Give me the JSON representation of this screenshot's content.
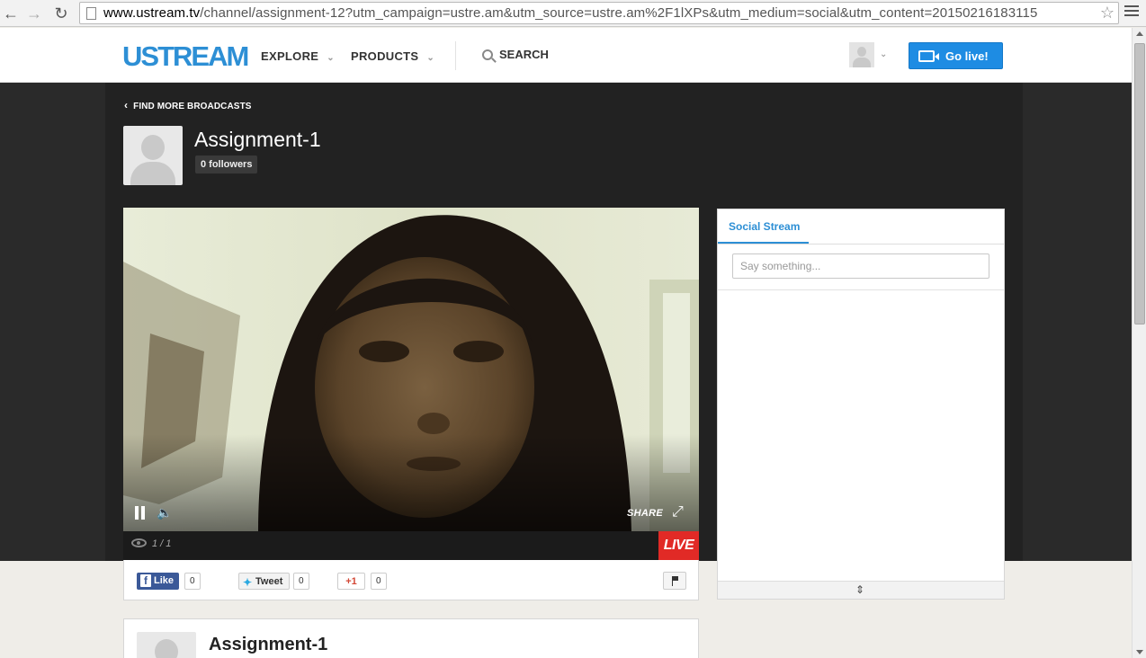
{
  "browser": {
    "url_host": "www.ustream.tv",
    "url_rest": "/channel/assignment-12?utm_campaign=ustre.am&utm_source=ustre.am%2F1lXPs&utm_medium=social&utm_content=20150216183115",
    "icons": {
      "back": "back-arrow-icon",
      "forward": "forward-arrow-icon",
      "reload": "reload-icon",
      "star": "bookmark-star-icon",
      "menu": "hamburger-menu-icon"
    }
  },
  "header": {
    "logo": "USTREAM",
    "nav": {
      "explore": "EXPLORE",
      "products": "PRODUCTS"
    },
    "search": "SEARCH",
    "go_live": "Go live!",
    "brand_color": "#2d8fd5"
  },
  "channel": {
    "back_link": "FIND MORE BROADCASTS",
    "title": "Assignment-1",
    "followers": "0 followers"
  },
  "player": {
    "share": "SHARE",
    "viewers": "1 / 1",
    "live": "LIVE",
    "live_color": "#e12a26"
  },
  "social": {
    "like_label": "Like",
    "like_count": "0",
    "tweet_label": "Tweet",
    "tweet_count": "0",
    "gplus_label": "+1",
    "gplus_count": "0"
  },
  "stream": {
    "tab": "Social Stream",
    "placeholder": "Say something..."
  },
  "info": {
    "title": "Assignment-1"
  }
}
